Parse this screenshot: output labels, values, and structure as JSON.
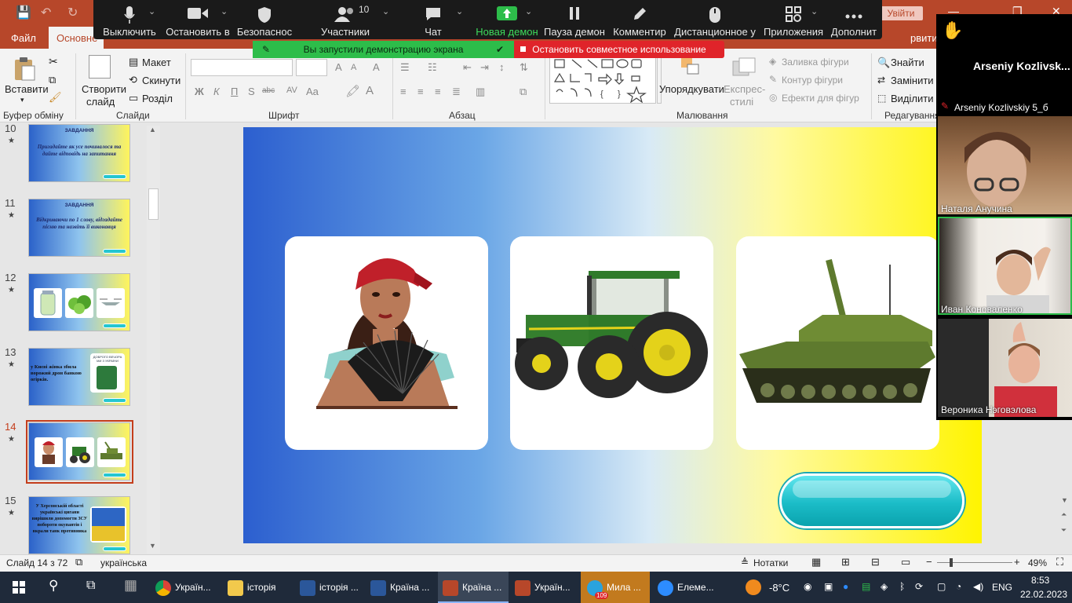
{
  "window": {
    "login_label": "Увійти",
    "controls": [
      "—",
      "❐",
      "✕"
    ]
  },
  "ribbon": {
    "tabs": {
      "file": "Файл",
      "home": "Основне",
      "extra": "рвити"
    },
    "clipboard": {
      "paste": "Вставити",
      "group": "Буфер обміну"
    },
    "slides": {
      "new_line1": "Створити",
      "new_line2": "слайд",
      "layout": "Макет",
      "reset": "Скинути",
      "section": "Розділ",
      "group": "Слайди"
    },
    "font": {
      "group": "Шрифт",
      "bold": "Ж",
      "italic": "К",
      "underline": "П",
      "shadow": "S",
      "strike": "abc",
      "case": "Aa",
      "grow": "A",
      "shrink": "A",
      "clear": "A"
    },
    "paragraph": {
      "group": "Абзац"
    },
    "drawing": {
      "arrange": "Упорядкувати",
      "quick_styles_line1": "Експрес-",
      "quick_styles_line2": "стилі",
      "shape_fill": "Заливка фігури",
      "shape_outline": "Контур фігури",
      "shape_effects": "Ефекти для фігур",
      "group": "Малювання"
    },
    "editing": {
      "find": "Знайти",
      "replace": "Замінити",
      "select": "Виділити",
      "group": "Редагування"
    }
  },
  "zoom_toolbar": {
    "buttons": [
      {
        "label": "Выключить",
        "icon": "microphone-icon"
      },
      {
        "label": "Остановить в",
        "icon": "video-camera-icon"
      },
      {
        "label": "Безопаснос",
        "icon": "shield-icon"
      },
      {
        "label": "Участники",
        "icon": "participants-icon",
        "count": "10"
      },
      {
        "label": "Чат",
        "icon": "chat-icon"
      },
      {
        "label": "Новая демон",
        "icon": "share-screen-icon"
      },
      {
        "label": "Пауза демон",
        "icon": "pause-icon"
      },
      {
        "label": "Комментир",
        "icon": "annotate-icon"
      },
      {
        "label": "Дистанционное у",
        "icon": "remote-control-icon"
      },
      {
        "label": "Приложения",
        "icon": "apps-icon"
      },
      {
        "label": "Дополнит",
        "icon": "more-icon"
      }
    ],
    "share_notice": "Вы запустили демонстрацию экрана",
    "stop_share": "Остановить совместное использование",
    "accent": "#2dbd4a",
    "stop_color": "#e0242a"
  },
  "slides_panel": {
    "items": [
      {
        "num": "10",
        "heading": "ЗАВДАННЯ",
        "text": "Пригадайте як усе починалося та дайте відповідь на запитання"
      },
      {
        "num": "11",
        "heading": "ЗАВДАННЯ",
        "text": "Відкриваючи по 1 слову, відгадайте пісню та назвіть її виконавця"
      },
      {
        "num": "12",
        "heading": "",
        "text": ""
      },
      {
        "num": "13",
        "heading": "",
        "text": "у Києві жінка збила ворожий дрон банкою огірків.",
        "badge": "ДОБРОГО ВЕЧОРА МИ З УКРАЇНИ"
      },
      {
        "num": "14",
        "heading": "",
        "text": ""
      },
      {
        "num": "15",
        "heading": "",
        "text": "У Херсонській області українські цигани вирішили допомогти ЗСУ поборoти окупантів і вкрали танк противника"
      }
    ],
    "selected": "14"
  },
  "slide": {
    "cards": [
      {
        "subject": "woman-with-fan"
      },
      {
        "subject": "green-tractor"
      },
      {
        "subject": "green-tank"
      }
    ],
    "button_color": "#1bbcc7"
  },
  "participants": {
    "host_name": "Arseniy  Kozlivsk...",
    "host_tile_label": "Arseniy Kozlivskiy 5_б",
    "videos": [
      {
        "name": "Наталя Анучина"
      },
      {
        "name": "Иван Коноваленко"
      },
      {
        "name": "Вероника Нэговэлова"
      }
    ]
  },
  "statusbar": {
    "slide_counter": "Слайд 14 з 72",
    "language": "українська",
    "notes": "Нотатки",
    "zoom": "49%"
  },
  "taskbar": {
    "apps": [
      {
        "label": "Україн...",
        "icon": "chrome-icon"
      },
      {
        "label": "історія",
        "icon": "folder-icon"
      },
      {
        "label": "історія ...",
        "icon": "word-icon"
      },
      {
        "label": "Країна ...",
        "icon": "word-icon"
      },
      {
        "label": "Країна ...",
        "icon": "powerpoint-icon"
      },
      {
        "label": "Україн...",
        "icon": "powerpoint-icon"
      },
      {
        "label": "Мила ...",
        "icon": "telegram-icon",
        "badge": "109"
      },
      {
        "label": "Елеме...",
        "icon": "zoom-icon"
      }
    ],
    "weather": "-8°C",
    "lang": "ENG",
    "time": "8:53",
    "date": "22.02.2023"
  }
}
